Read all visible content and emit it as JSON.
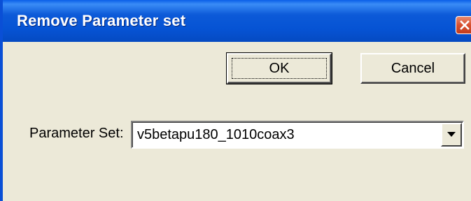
{
  "window": {
    "title": "Remove Parameter set",
    "close_icon": "close-icon"
  },
  "dialog": {
    "ok_label": "OK",
    "cancel_label": "Cancel",
    "parameter_set_label": "Parameter Set:",
    "parameter_set_value": "v5betapu180_1010coax3",
    "dropdown_icon": "chevron-down-icon"
  },
  "colors": {
    "titlebar": "#0653d4",
    "close_button": "#d8502f",
    "dialog_background": "#ece9d8"
  }
}
